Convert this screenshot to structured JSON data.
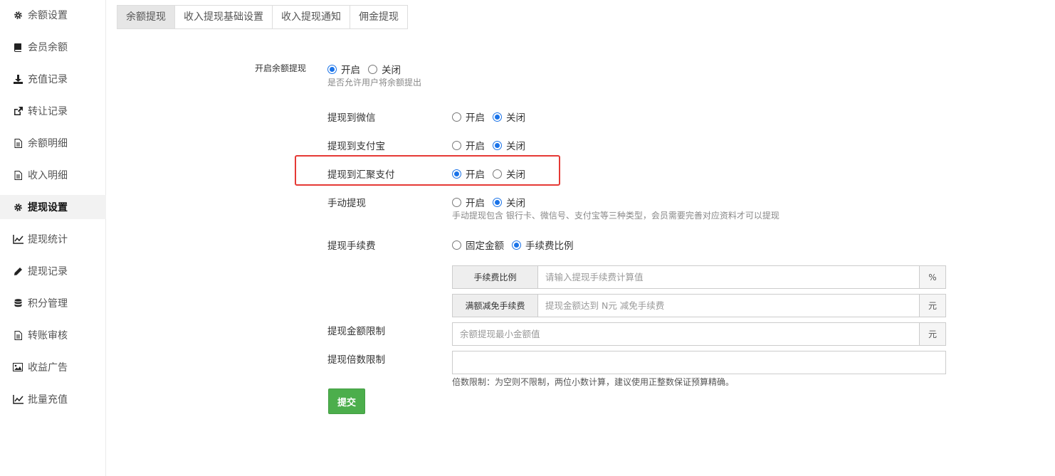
{
  "sidebar": {
    "items": [
      {
        "label": "余额设置",
        "icon": "gear-icon"
      },
      {
        "label": "会员余额",
        "icon": "book-icon"
      },
      {
        "label": "充值记录",
        "icon": "download-icon"
      },
      {
        "label": "转让记录",
        "icon": "external-link-icon"
      },
      {
        "label": "余额明细",
        "icon": "file-icon"
      },
      {
        "label": "收入明细",
        "icon": "file-icon"
      },
      {
        "label": "提现设置",
        "icon": "gear-icon",
        "active": true
      },
      {
        "label": "提现统计",
        "icon": "line-chart-icon"
      },
      {
        "label": "提现记录",
        "icon": "pencil-icon"
      },
      {
        "label": "积分管理",
        "icon": "database-icon"
      },
      {
        "label": "转账审核",
        "icon": "file-icon"
      },
      {
        "label": "收益广告",
        "icon": "image-icon"
      },
      {
        "label": "批量充值",
        "icon": "line-chart-icon"
      }
    ]
  },
  "tabs": [
    {
      "label": "余额提现",
      "active": true
    },
    {
      "label": "收入提现基础设置"
    },
    {
      "label": "收入提现通知"
    },
    {
      "label": "佣金提现"
    }
  ],
  "form": {
    "enable_withdraw": {
      "label": "开启余额提现",
      "options": [
        "开启",
        "关闭"
      ],
      "selected": "开启",
      "help": "是否允许用户将余额提出"
    },
    "to_wechat": {
      "label": "提现到微信",
      "options": [
        "开启",
        "关闭"
      ],
      "selected": "关闭"
    },
    "to_alipay": {
      "label": "提现到支付宝",
      "options": [
        "开启",
        "关闭"
      ],
      "selected": "关闭"
    },
    "to_huiju": {
      "label": "提现到汇聚支付",
      "options": [
        "开启",
        "关闭"
      ],
      "selected": "开启"
    },
    "manual": {
      "label": "手动提现",
      "options": [
        "开启",
        "关闭"
      ],
      "selected": "关闭",
      "help": "手动提现包含 银行卡、微信号、支付宝等三种类型，会员需要完善对应资料才可以提现"
    },
    "fee": {
      "label": "提现手续费",
      "options": [
        "固定金额",
        "手续费比例"
      ],
      "selected": "手续费比例"
    },
    "fee_ratio": {
      "addon": "手续费比例",
      "placeholder": "请输入提现手续费计算值",
      "value": "",
      "suffix": "%"
    },
    "fee_exempt": {
      "addon": "满额减免手续费",
      "placeholder": "提现金额达到 N元 减免手续费",
      "value": "",
      "suffix": "元"
    },
    "amount_limit": {
      "label": "提现金额限制",
      "placeholder": "余额提现最小金额值",
      "value": "",
      "suffix": "元"
    },
    "multiple_limit": {
      "label": "提现倍数限制",
      "value": "",
      "help": "倍数限制：为空则不限制，两位小数计算，建议使用正整数保证预算精确。"
    },
    "submit_label": "提交"
  },
  "colors": {
    "accent": "#1a73e8",
    "submit": "#4cae4c",
    "highlight": "#e53935"
  }
}
